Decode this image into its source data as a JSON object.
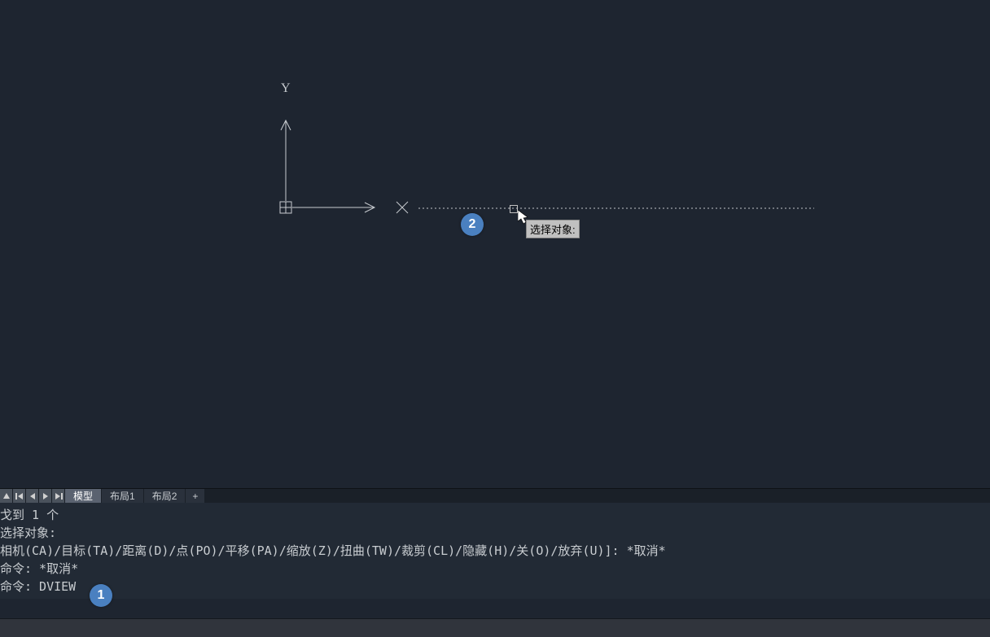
{
  "ucs": {
    "x_label": "X",
    "y_label": "Y"
  },
  "tooltip": {
    "text": "选择对象:"
  },
  "callouts": {
    "c1": "1",
    "c2": "2"
  },
  "tabs": {
    "model": "模型",
    "layout1": "布局1",
    "layout2": "布局2",
    "add": "+"
  },
  "command_history": {
    "line1": "戈到 1 个",
    "line2": "选择对象:",
    "line3": "相机(CA)/目标(TA)/距离(D)/点(PO)/平移(PA)/缩放(Z)/扭曲(TW)/裁剪(CL)/隐藏(H)/关(O)/放弃(U)]: *取消*",
    "line4": "命令: *取消*",
    "line5": "命令: DVIEW"
  }
}
